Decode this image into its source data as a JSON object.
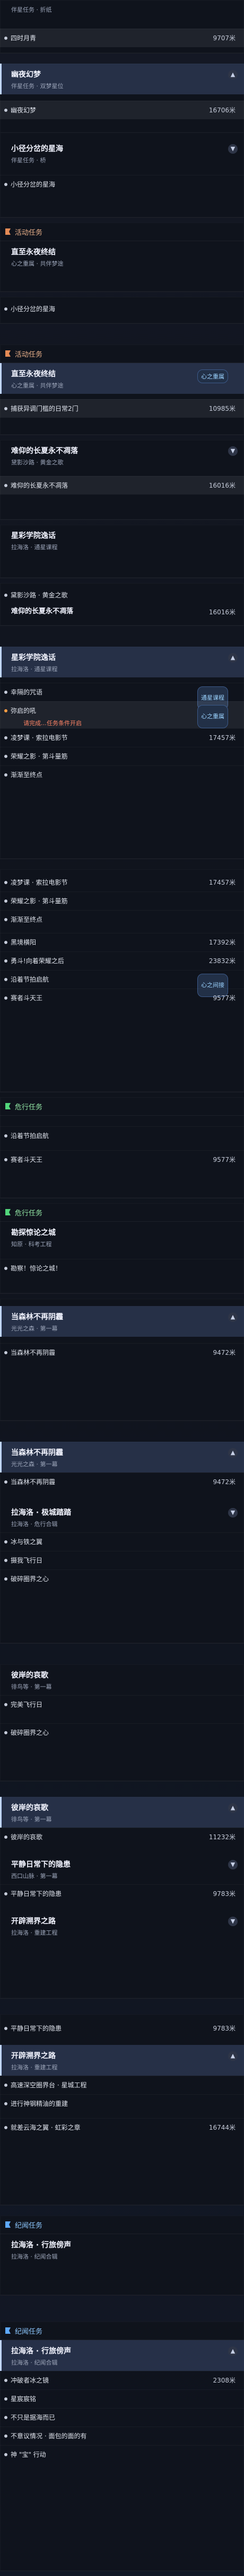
{
  "blocks": [
    {
      "id": "b1",
      "header": null,
      "missions": [
        {
          "title": "",
          "sub": "伴星任务 · 折纸",
          "steps": [
            {
              "label": "四时月青",
              "dist": "9707米"
            }
          ]
        }
      ]
    },
    {
      "id": "b2",
      "missions": [
        {
          "title": "幽夜幻梦",
          "sub": "伴星任务 · 双梦星位",
          "steps": [
            {
              "label": "幽夜幻梦",
              "dist": "16706米"
            }
          ]
        }
      ]
    },
    {
      "id": "b3",
      "missions": [
        {
          "title": "小径分岔的星海",
          "sub": "伴星任务 · 桥",
          "steps": [
            {
              "label": "小径分岔的星海"
            }
          ]
        }
      ]
    },
    {
      "id": "b4",
      "header": "活动任务",
      "missions": [
        {
          "title": "直至永夜终结",
          "sub": "心之重属 · 共伴梦途",
          "steps": [
            {
              "label": "小径分岔的星海"
            }
          ]
        }
      ]
    },
    {
      "id": "b5",
      "header": "活动任务",
      "missions": [
        {
          "title": "直至永夜终结",
          "sub": "心之重属 · 共伴梦途",
          "badge": "心之重属",
          "steps": [
            {
              "label": "捕获异调门槛的日常2门",
              "dist": "10985米"
            }
          ]
        }
      ]
    },
    {
      "id": "b6",
      "missions": [
        {
          "title": "难仰的长夏永不凋落",
          "sub": "黛影沙路 · 黄金之歌",
          "steps": [
            {
              "label": "难仰的长夏永不凋落",
              "dist": "16016米"
            }
          ]
        }
      ]
    },
    {
      "id": "b7",
      "missions": [
        {
          "title": "星彩学院逸话",
          "sub": "拉海洛 · 通星课程",
          "steps": [
            {
              "label": "黛影沙路 · 黄金之歌"
            }
          ]
        }
      ]
    },
    {
      "id": "b8",
      "missions": [
        {
          "title": "难仰的长夏永不凋落",
          "dist": "16016米"
        }
      ]
    },
    {
      "id": "b9",
      "missions": [
        {
          "title": "星彩学院逸话",
          "sub": "拉海洛 · 通星课程",
          "badge": "通星课程",
          "steps": [
            {
              "label": "幸隔的咒语",
              "label2": "",
              "dist": ""
            },
            {
              "label": "弥启的吼",
              "warn": "请完成 … 任务条件开启"
            },
            {
              "label": "凌梦课 · 索拉电影节",
              "dist": "17457米"
            },
            {
              "label": "荣耀之影 · 第斗量筋"
            },
            {
              "label": "渐渐至终点"
            }
          ]
        }
      ]
    },
    {
      "id": "b10",
      "missions": [
        {
          "title": "",
          "steps": [
            {
              "label": "凌梦课 · 索拉电影节",
              "dist": "17457米"
            },
            {
              "label": "荣耀之影 · 第斗量筋"
            },
            {
              "label": "渐渐至终点"
            },
            {
              "label": "黑境横阳",
              "dist": "17392米"
            },
            {
              "label": "勇斗!向着荣耀之后",
              "dist": "23832米"
            },
            {
              "label": "沿着节拍启航"
            },
            {
              "label": "赛者斗天王",
              "dist": "9577米"
            }
          ]
        }
      ]
    },
    {
      "id": "b11",
      "header": "危行任务",
      "steps": [
        {
          "label": "沿着节拍启航"
        },
        {
          "label": "赛者斗天王",
          "dist": "9577米"
        }
      ]
    },
    {
      "id": "b12",
      "header": "危行任务",
      "missions": [
        {
          "title": "勘探惊论之城",
          "sub": "知原 · 科考工程"
        },
        {
          "title": "",
          "sub": "",
          "steps": [
            {
              "label": "勘察！惊论之城！"
            }
          ]
        }
      ]
    },
    {
      "id": "b13",
      "missions": [
        {
          "title": "当森林不再阴霾",
          "sub": "光光之森 · 第一幕",
          "steps": [
            {
              "label": "当森林不再阴霾",
              "dist": "9472米"
            }
          ]
        }
      ]
    },
    {
      "id": "b14",
      "missions": [
        {
          "title": "当森林不再阴霾",
          "sub": "光光之森 · 第一幕",
          "steps": [
            {
              "label": "当森林不再阴霾",
              "dist": "9472米"
            }
          ]
        },
        {
          "title": "拉海洛 · 极城踏踏",
          "sub": "拉海洛 · 危行合辑",
          "steps": [
            {
              "label": "冰与铁之翼"
            },
            {
              "label": "摄我飞行日"
            },
            {
              "label": "破碎圈界之心"
            }
          ]
        }
      ]
    },
    {
      "id": "b15",
      "missions": [
        {
          "title": "彼岸的哀歌",
          "sub": "徘鸟等 · 第一幕",
          "steps": [
            {
              "label": "完美飞行日"
            },
            {
              "label": "破碎圈界之心"
            }
          ]
        }
      ]
    },
    {
      "id": "b16",
      "missions": [
        {
          "title": "彼岸的哀歌",
          "sub": "徘鸟等 · 第一幕",
          "steps": [
            {
              "label": "彼岸的哀歌",
              "dist": "11232米"
            }
          ]
        },
        {
          "title": "平静日常下的隐患",
          "sub": "西口山脉 · 第一幕",
          "steps": [
            {
              "label": "平静日常下的隐患",
              "dist": "9783米"
            }
          ]
        },
        {
          "title": "开辟溯界之路",
          "sub": "拉海洛 · 重建工程"
        }
      ]
    },
    {
      "id": "b17",
      "missions": [
        {
          "title": "",
          "steps": [
            {
              "label": "平静日常下的隐患",
              "dist": "9783米"
            }
          ]
        },
        {
          "title": "开辟溯界之路",
          "sub": "拉海洛 · 重建工程",
          "steps": [
            {
              "label": "高速深空圈界台 · 星城工程"
            },
            {
              "label": "进行神钢精油的重建"
            },
            {
              "label": "就差云海之翼 · 虹彩之章",
              "dist": "16744米"
            }
          ]
        }
      ]
    },
    {
      "id": "b18",
      "header": "纪闻任务",
      "missions": [
        {
          "title": "拉海洛 · 行旅傍声",
          "sub": "拉海洛 · 纪闻合辑"
        }
      ]
    },
    {
      "id": "b19",
      "header": "纪闻任务",
      "missions": [
        {
          "title": "拉海洛 · 行旅傍声",
          "sub": "拉海洛 · 纪闻合辑",
          "steps": [
            {
              "label": "冲破者冰之镜",
              "dist": "2308米"
            },
            {
              "label": "星宸宸铭"
            },
            {
              "label": "不只是据海而已"
            },
            {
              "label": "不意议情况 · 面包的面的有"
            },
            {
              "label": "神 \"宝\" 行动"
            }
          ]
        }
      ]
    }
  ],
  "texts": {
    "b1_sub": "伴星任务 · 折纸",
    "b1_step": "四时月青",
    "b1_dist": "9707米",
    "b2_title": "幽夜幻梦",
    "b2_sub": "伴星任务 · 双梦星位",
    "b2_step": "幽夜幻梦",
    "b2_dist": "16706米",
    "b3_title": "小径分岔的星海",
    "b3_sub": "伴星任务 · 桥",
    "b3_step": "小径分岔的星海",
    "h_activity": "活动任务",
    "b4_title": "直至永夜终结",
    "b4_sub": "心之重属 · 共伴梦途",
    "b4_step": "小径分岔的星海",
    "b5_title": "直至永夜终结",
    "b5_sub": "心之重属 · 共伴梦途",
    "b5_badge": "心之重属",
    "b5_step": "捕获异调门槛的日常2门",
    "b5_dist": "10985米",
    "b6_title": "难仰的长夏永不凋落",
    "b6_sub": "黛影沙路 · 黄金之歌",
    "b6_step": "难仰的长夏永不凋落",
    "b6_dist": "16016米",
    "b7_title": "星彩学院逸话",
    "b7_sub": "拉海洛 · 通星课程",
    "b7_step": "黛影沙路 · 黄金之歌",
    "b8_title": "难仰的长夏永不凋落",
    "b8_dist": "16016米",
    "b9_title": "星彩学院逸话",
    "b9_sub": "拉海洛 · 通星课程",
    "b9_badge1": "通星课程",
    "b9_step1": "幸隔的咒语",
    "b9_step2": "弥启的吼",
    "b9_warn": "请完成…任务条件开启",
    "b9_badge2": "心之重属",
    "b9_step3": "凌梦课 · 索拉电影节",
    "b9_dist3": "17457米",
    "b9_step4": "荣耀之影 · 第斗量筋",
    "b9_step5": "渐渐至终点",
    "b10_step1": "凌梦课 · 索拉电影节",
    "b10_dist1": "17457米",
    "b10_step2": "荣耀之影 · 第斗量筋",
    "b10_step3": "渐渐至终点",
    "b10_step4": "黑境横阳",
    "b10_dist4": "17392米",
    "b10_step5": "勇斗!向着荣耀之后",
    "b10_dist5": "23832米",
    "b10_step6": "沿着节拍启航",
    "b10_badge": "心之间接",
    "b10_step7": "赛者斗天王",
    "b10_dist7": "9577米",
    "h_danger": "危行任务",
    "b11_step1": "沿着节拍启航",
    "b11_step2": "赛者斗天王",
    "b11_dist2": "9577米",
    "b12_title": "勘探惊论之城",
    "b12_sub": "知原 · 科考工程",
    "b12_step": "勘察！惊论之城！",
    "b13_title": "当森林不再阴霾",
    "b13_sub": "光光之森 · 第一幕",
    "b13_step": "当森林不再阴霾",
    "b13_dist": "9472米",
    "b14_title": "当森林不再阴霾",
    "b14_sub": "光光之森 · 第一幕",
    "b14_step": "当森林不再阴霾",
    "b14_dist": "9472米",
    "b14_title2": "拉海洛 · 极城踏踏",
    "b14_sub2": "拉海洛 · 危行合辑",
    "b14_step2": "冰与铁之翼",
    "b14_step3": "摄我飞行日",
    "b14_step4": "破碎圈界之心",
    "b15_title": "彼岸的哀歌",
    "b15_sub": "徘鸟等 · 第一幕",
    "b15_step1": "完美飞行日",
    "b15_step2": "破碎圈界之心",
    "b16_title": "彼岸的哀歌",
    "b16_sub": "徘鸟等 · 第一幕",
    "b16_step": "彼岸的哀歌",
    "b16_dist": "11232米",
    "b16_title2": "平静日常下的隐患",
    "b16_sub2": "西口山脉 · 第一幕",
    "b16_step2": "平静日常下的隐患",
    "b16_dist2": "9783米",
    "b16_title3": "开辟溯界之路",
    "b16_sub3": "拉海洛 · 重建工程",
    "b17_step1": "平静日常下的隐患",
    "b17_dist1": "9783米",
    "b17_title": "开辟溯界之路",
    "b17_sub": "拉海洛 · 重建工程",
    "b17_step2": "高速深空圈界台 · 星城工程",
    "b17_step3": "进行神钢精油的重建",
    "b17_step4": "就差云海之翼 · 虹彩之章",
    "b17_dist4": "16744米",
    "h_record": "纪闻任务",
    "b18_title": "拉海洛 · 行旅傍声",
    "b18_sub": "拉海洛 · 纪闻合辑",
    "b19_title": "拉海洛 · 行旅傍声",
    "b19_sub": "拉海洛 · 纪闻合辑",
    "b19_step1": "冲破者冰之镜",
    "b19_dist1": "2308米",
    "b19_step2": "星宸宸铭",
    "b19_step3": "不只是据海而已",
    "b19_step4": "不意议情况 · 面包的面的有",
    "b19_step5": "神 \"宝\" 行动"
  }
}
